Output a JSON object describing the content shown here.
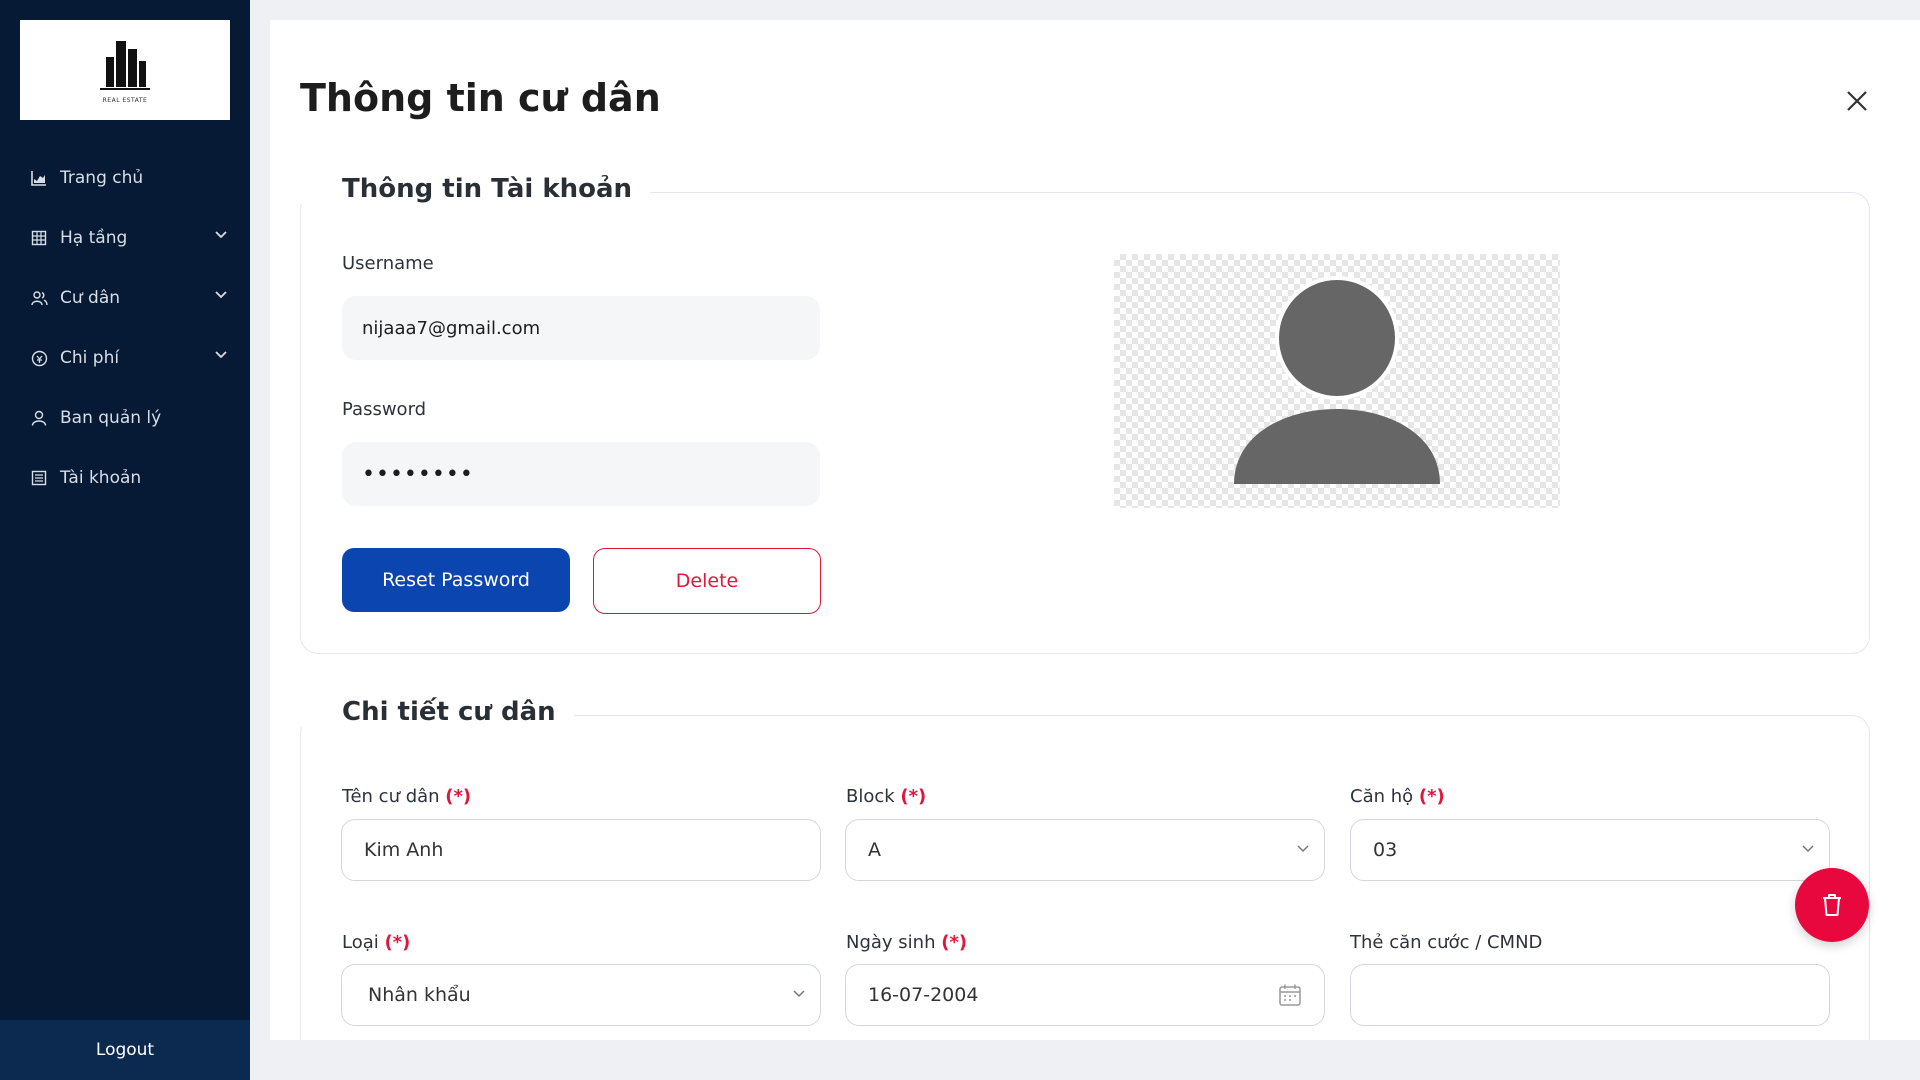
{
  "sidebar": {
    "logo_text": "REAL ESTATE",
    "items": [
      {
        "label": "Trang chủ",
        "icon": "chart-icon"
      },
      {
        "label": "Hạ tầng",
        "icon": "building-icon"
      },
      {
        "label": "Cư dân",
        "icon": "users-icon"
      },
      {
        "label": "Chi phí",
        "icon": "coin-icon"
      },
      {
        "label": "Ban quản lý",
        "icon": "user-icon"
      },
      {
        "label": "Tài khoản",
        "icon": "list-icon"
      }
    ],
    "logout": "Logout"
  },
  "page": {
    "title": "Thông tin cư dân"
  },
  "account": {
    "legend": "Thông tin Tài khoản",
    "username_label": "Username",
    "username_value": "nijaaa7@gmail.com",
    "password_label": "Password",
    "password_value": "••••••••",
    "reset_button": "Reset Password",
    "delete_button": "Delete"
  },
  "details": {
    "legend": "Chi tiết cư dân",
    "required_mark": "(*)",
    "name_label": "Tên cư dân",
    "name_value": "Kim Anh",
    "block_label": "Block",
    "block_value": "A",
    "apartment_label": "Căn hộ",
    "apartment_value": "03",
    "type_label": "Loại",
    "type_value": "Nhân khẩu",
    "dob_label": "Ngày sinh",
    "dob_value": "16-07-2004",
    "id_label": "Thẻ căn cước / CMND",
    "id_value": ""
  },
  "colors": {
    "sidebar_bg": "#071a35",
    "primary": "#0b45b0",
    "danger": "#e0173c"
  }
}
